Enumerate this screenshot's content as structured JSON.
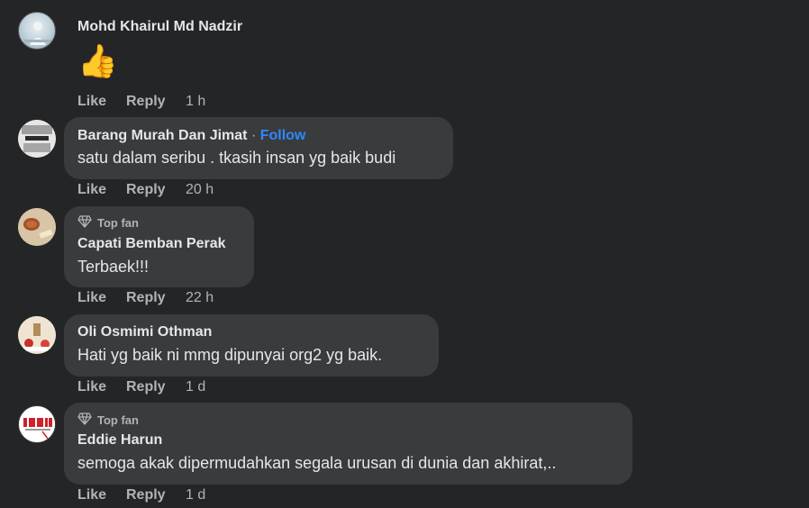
{
  "comments": [
    {
      "author": "Mohd Khairul Md Nadzir",
      "emoji": "👍",
      "like": "Like",
      "reply": "Reply",
      "time": "1 h"
    },
    {
      "author": "Barang Murah Dan Jimat",
      "sep": "·",
      "follow": "Follow",
      "text": "satu dalam seribu . tkasih insan yg baik budi",
      "like": "Like",
      "reply": "Reply",
      "time": "20 h"
    },
    {
      "badge": "Top fan",
      "author": "Capati Bemban Perak",
      "text": "Terbaek!!!",
      "like": "Like",
      "reply": "Reply",
      "time": "22 h"
    },
    {
      "author": "Oli Osmimi Othman",
      "text": "Hati yg baik ni mmg dipunyai org2 yg baik.",
      "like": "Like",
      "reply": "Reply",
      "time": "1 d"
    },
    {
      "badge": "Top fan",
      "author": "Eddie Harun",
      "text": "semoga akak dipermudahkan segala urusan di dunia dan akhirat,..",
      "like": "Like",
      "reply": "Reply",
      "time": "1 d"
    }
  ],
  "colors": {
    "background": "#242526",
    "bubble": "#3a3b3c",
    "text": "#e4e6eb",
    "secondary": "#b0b3b8",
    "link": "#2d88ff"
  }
}
